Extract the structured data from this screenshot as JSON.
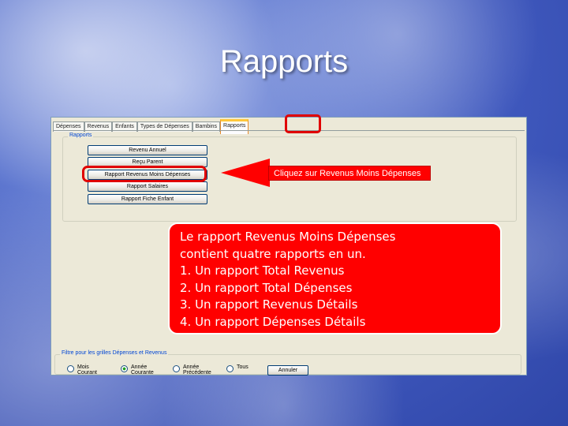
{
  "slide": {
    "title": "Rapports"
  },
  "app": {
    "tabs": [
      "Dépenses",
      "Revenus",
      "Enfants",
      "Types de Dépenses",
      "Bambins",
      "Rapports"
    ],
    "reports_group": {
      "legend": "Rapports",
      "buttons": [
        "Revenu Annuel",
        "Reçu Parent",
        "Rapport Revenus Moins Dépenses",
        "Rapport Salaires",
        "Rapport Fiche Enfant"
      ]
    },
    "filter_group": {
      "legend": "Filtre pour les grilles Dépenses et Revenus",
      "options": [
        [
          "Mois",
          "Courant"
        ],
        [
          "Année",
          "Courante"
        ],
        [
          "Année",
          "Précédente"
        ],
        [
          "Tous",
          ""
        ]
      ],
      "selected_index": 1,
      "cancel_label": "Annuler"
    }
  },
  "callout": {
    "text": "Cliquez sur Revenus Moins Dépenses",
    "color": "#ff0000"
  },
  "info": {
    "lines": [
      "Le rapport Revenus Moins Dépenses",
      "contient quatre rapports en un.",
      "1. Un rapport Total Revenus",
      "2. Un rapport Total Dépenses",
      "3. Un rapport Revenus Détails",
      "4. Un rapport Dépenses Détails"
    ],
    "color": "#ff0000"
  }
}
